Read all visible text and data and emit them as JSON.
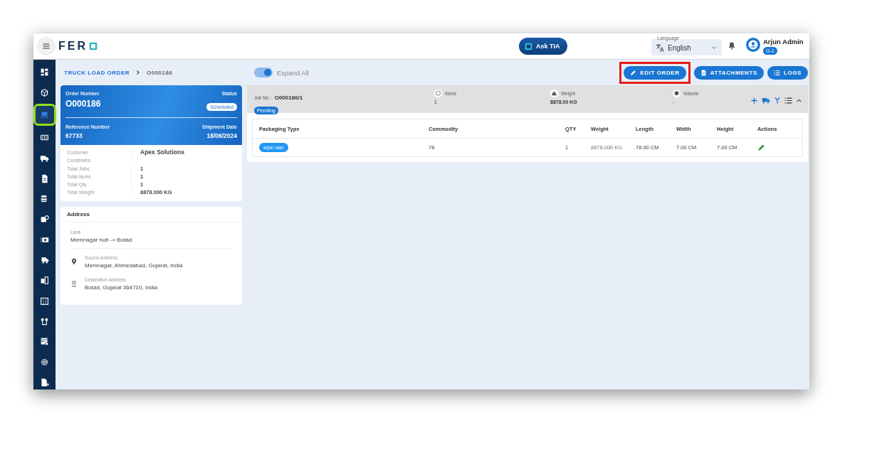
{
  "topbar": {
    "logo_text": "FER",
    "ask_button": "Ask TIA",
    "language": {
      "label": "Language",
      "value": "English"
    },
    "user": {
      "name": "Arjun Admin",
      "badge": "G-1"
    }
  },
  "sidebar": {
    "items": [
      {
        "selected": false,
        "highlighted": false
      },
      {
        "selected": false,
        "highlighted": false
      },
      {
        "selected": true,
        "highlighted": true
      },
      {
        "selected": false,
        "highlighted": false
      },
      {
        "selected": false,
        "highlighted": false
      },
      {
        "selected": false,
        "highlighted": false
      },
      {
        "selected": false,
        "highlighted": false
      },
      {
        "selected": false,
        "highlighted": false
      },
      {
        "selected": false,
        "highlighted": false
      },
      {
        "selected": false,
        "highlighted": false
      },
      {
        "selected": false,
        "highlighted": false
      },
      {
        "selected": false,
        "highlighted": false
      },
      {
        "selected": false,
        "highlighted": false
      },
      {
        "selected": false,
        "highlighted": false
      },
      {
        "selected": false,
        "highlighted": false
      },
      {
        "selected": false,
        "highlighted": false
      }
    ]
  },
  "breadcrumb": [
    "TRUCK LOAD ORDER",
    "O000186"
  ],
  "expand_all": {
    "label": "Expand All",
    "on": true
  },
  "actions": [
    {
      "kind": "edit",
      "label": "EDIT ORDER",
      "highlighted": true
    },
    {
      "kind": "attach",
      "label": "ATTACHMENTS",
      "highlighted": false
    },
    {
      "kind": "logs",
      "label": "LOGS",
      "highlighted": false
    }
  ],
  "order": {
    "order_number_label": "Order Number",
    "order_number": "O000186",
    "status_label": "Status",
    "status": "Scheduled",
    "reference_label": "Reference Number",
    "reference": "67733",
    "shipment_date_label": "Shipment Date",
    "shipment_date": "18/06/2024",
    "details": [
      {
        "label": "Customer",
        "separator": ":",
        "value": "Apex Solutions"
      },
      {
        "label": "Constrains",
        "separator": ":"
      },
      {
        "label": "Total Jobs",
        "separator": ":",
        "value": "1"
      },
      {
        "label": "Total Items",
        "separator": ":",
        "value": "1"
      },
      {
        "label": "Total Qty",
        "separator": ":",
        "value": "1"
      },
      {
        "label": "Total Weight",
        "separator": ":",
        "value": "8878.000   KG"
      }
    ]
  },
  "address": {
    "title": "Address",
    "lane_label": "Lane",
    "lane": "Memnagar hub -> Botad",
    "source_label": "Source Address",
    "source": "Memnagar, Ahmedabad, Gujarat, India",
    "destination_label": "Destination Address",
    "destination": "Botad, Gujarat 364710, India"
  },
  "job": {
    "job_no_label": "Job No :",
    "job_no": "O000186/1",
    "status": "Pending",
    "stats": [
      {
        "kind": "items",
        "label": "Items",
        "value": "1"
      },
      {
        "kind": "weight",
        "label": "Weight",
        "value": "8878.00 KG"
      },
      {
        "kind": "volume",
        "label": "Volume",
        "value": "-"
      }
    ],
    "table": {
      "columns": [
        "Packaging Type",
        "Commodity",
        "QTY",
        "Weight",
        "Length",
        "Width",
        "Height",
        "Actions"
      ],
      "rows": [
        {
          "packaging_type": "arjun user",
          "commodity": "78",
          "qty": "1",
          "weight": "8878.000 KG",
          "length": "78.00 CM",
          "width": "7.00 CM",
          "height": "7.00 CM"
        }
      ]
    }
  }
}
